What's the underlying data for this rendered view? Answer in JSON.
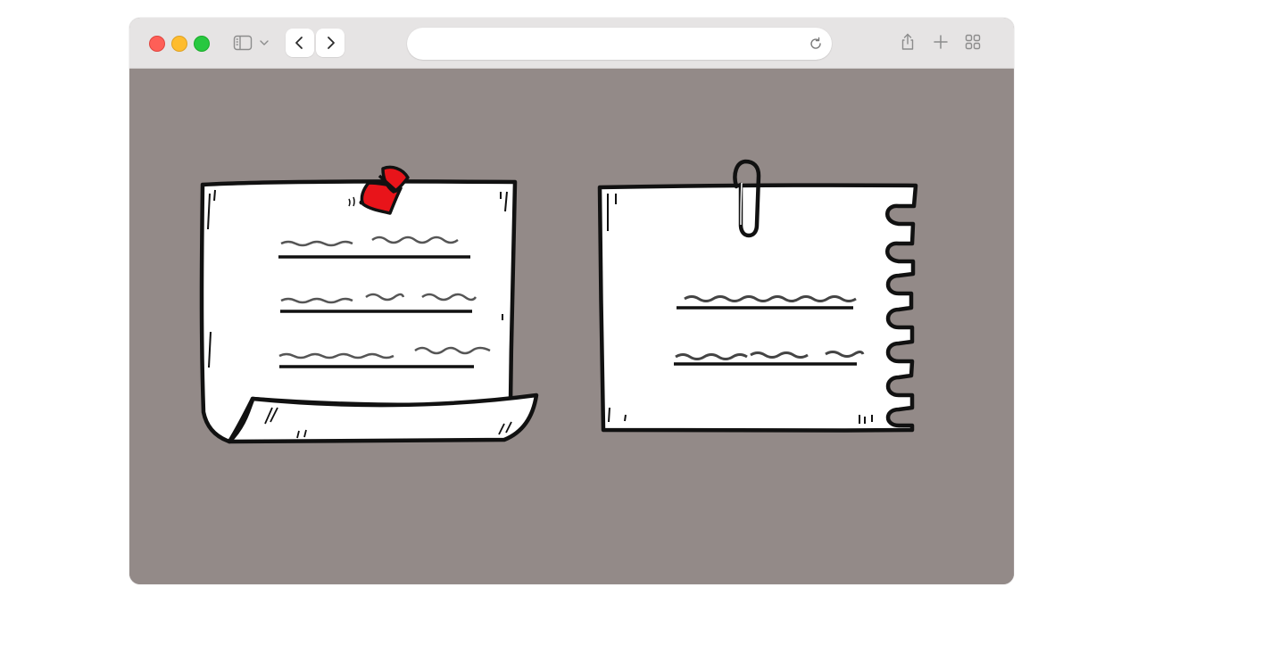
{
  "colors": {
    "page_background": "#ffffff",
    "content_background": "#938a88",
    "toolbar_background": "#e6e4e4",
    "pin": "#e8141a",
    "traffic_red": "#fe5f57",
    "traffic_yellow": "#febc2e",
    "traffic_green": "#28c840"
  },
  "toolbar": {
    "address_value": "",
    "icons": [
      "sidebar-icon",
      "chevron-down-icon",
      "back-arrow-icon",
      "forward-arrow-icon",
      "reload-icon",
      "share-icon",
      "plus-icon",
      "tab-overview-icon"
    ]
  },
  "content": {
    "illustration": [
      "pinned-note-illustration",
      "clipped-notebook-page-illustration"
    ]
  }
}
